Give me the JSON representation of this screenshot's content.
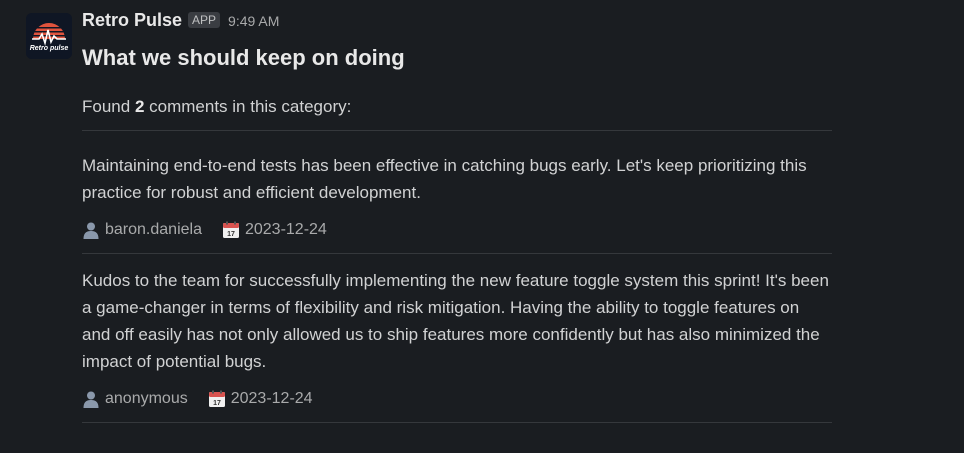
{
  "message": {
    "app_name": "Retro Pulse",
    "app_badge": "APP",
    "timestamp": "9:49 AM",
    "avatar_text": "Retro pulse",
    "title": "What we should keep on doing",
    "found_prefix": "Found",
    "found_count": "2",
    "found_suffix": "comments in this category:"
  },
  "comments": [
    {
      "text": "Maintaining end-to-end tests has been effective in catching bugs early. Let's keep prioritizing this practice for robust and efficient development.",
      "author": "baron.daniela",
      "date": "2023-12-24",
      "author_icon": "user-icon",
      "date_icon": "calendar-icon"
    },
    {
      "text": "Kudos to the team for successfully implementing the new feature toggle system this sprint! It's been a game-changer in terms of flexibility and risk mitigation. Having the ability to toggle features on and off easily has not only allowed us to ship features more confidently but has also minimized the impact of potential bugs.",
      "author": "anonymous",
      "date": "2023-12-24",
      "author_icon": "user-icon",
      "date_icon": "calendar-icon"
    }
  ],
  "colors": {
    "background": "#1a1d21",
    "text": "#d1d2d3",
    "muted": "#a9aaab",
    "divider": "#35383c",
    "avatar_red": "#e0533d"
  }
}
